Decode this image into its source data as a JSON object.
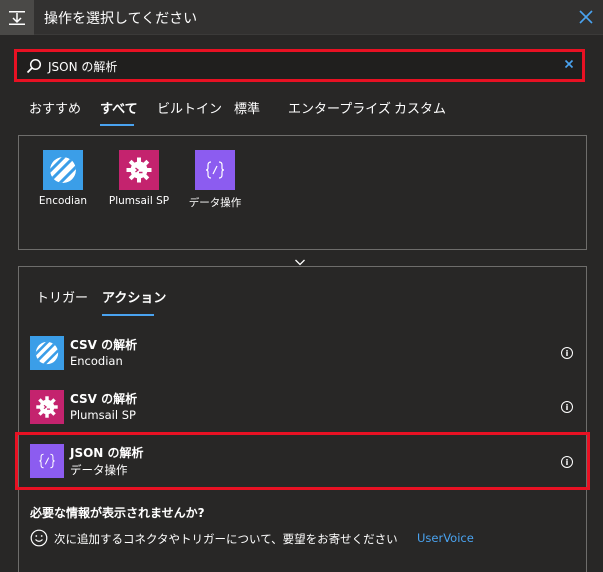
{
  "header": {
    "title": "操作を選択してください"
  },
  "search": {
    "value": "JSON の解析"
  },
  "tabs": [
    {
      "label": "おすすめ",
      "selected": false
    },
    {
      "label": "すべて",
      "selected": true
    },
    {
      "label": "ビルトイン",
      "selected": false
    },
    {
      "label": "標準",
      "selected": false
    },
    {
      "label": "エンタープライズ",
      "selected": false
    },
    {
      "label": "カスタム",
      "selected": false
    }
  ],
  "connectors": [
    {
      "label": "Encodian",
      "icon": "stripes-icon",
      "color": "#3b9ee8"
    },
    {
      "label": "Plumsail SP",
      "icon": "gear-icon",
      "color": "#c4236e"
    },
    {
      "label": "データ操作",
      "icon": "curly-braces-icon",
      "color": "#8c5cf0"
    }
  ],
  "subtabs": [
    {
      "label": "トリガー",
      "selected": false
    },
    {
      "label": "アクション",
      "selected": true
    }
  ],
  "actions": [
    {
      "title": "CSV の解析",
      "subtitle": "Encodian",
      "icon": "stripes-icon",
      "color": "#3b9ee8"
    },
    {
      "title": "CSV の解析",
      "subtitle": "Plumsail SP",
      "icon": "gear-icon",
      "color": "#c4236e"
    },
    {
      "title": "JSON の解析",
      "subtitle": "データ操作",
      "icon": "curly-braces-icon",
      "color": "#8c5cf0"
    }
  ],
  "footer": {
    "missing_title": "必要な情報が表示されませんか?",
    "request_text": "次に追加するコネクタやトリガーについて、要望をお寄せください",
    "uservoice_label": "UserVoice"
  }
}
